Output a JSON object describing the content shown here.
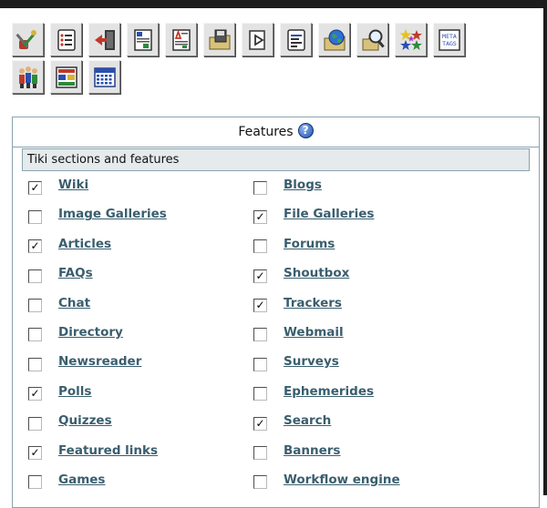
{
  "toolbar": {
    "rows": [
      [
        {
          "icon": "tools-icon"
        },
        {
          "icon": "list-icon"
        },
        {
          "icon": "login-icon"
        },
        {
          "icon": "wiki-page-icon"
        },
        {
          "icon": "article-page-icon"
        },
        {
          "icon": "floppy-folder-icon"
        },
        {
          "icon": "export-icon"
        },
        {
          "icon": "text-lines-icon"
        },
        {
          "icon": "globe-folder-icon"
        },
        {
          "icon": "search-folder-icon"
        },
        {
          "icon": "stars-icon"
        },
        {
          "icon": "meta-tags-icon",
          "label": "META\nTAGS"
        }
      ],
      [
        {
          "icon": "users-icon"
        },
        {
          "icon": "layout-icon"
        },
        {
          "icon": "calendar-icon"
        }
      ]
    ]
  },
  "panel": {
    "title": "Features",
    "help_symbol": "?",
    "section_title": "Tiki sections and features"
  },
  "features": [
    {
      "left": {
        "label": "Wiki",
        "checked": true
      },
      "right": {
        "label": "Blogs",
        "checked": false
      }
    },
    {
      "left": {
        "label": "Image Galleries",
        "checked": false
      },
      "right": {
        "label": "File Galleries",
        "checked": true
      }
    },
    {
      "left": {
        "label": "Articles",
        "checked": true
      },
      "right": {
        "label": "Forums",
        "checked": false
      }
    },
    {
      "left": {
        "label": "FAQs",
        "checked": false
      },
      "right": {
        "label": "Shoutbox",
        "checked": true
      }
    },
    {
      "left": {
        "label": "Chat",
        "checked": false
      },
      "right": {
        "label": "Trackers",
        "checked": true
      }
    },
    {
      "left": {
        "label": "Directory",
        "checked": false
      },
      "right": {
        "label": "Webmail",
        "checked": false
      }
    },
    {
      "left": {
        "label": "Newsreader",
        "checked": false
      },
      "right": {
        "label": "Surveys",
        "checked": false
      }
    },
    {
      "left": {
        "label": "Polls",
        "checked": true
      },
      "right": {
        "label": "Ephemerides",
        "checked": false
      }
    },
    {
      "left": {
        "label": "Quizzes",
        "checked": false
      },
      "right": {
        "label": "Search",
        "checked": true
      }
    },
    {
      "left": {
        "label": "Featured links",
        "checked": true
      },
      "right": {
        "label": "Banners",
        "checked": false
      }
    },
    {
      "left": {
        "label": "Games",
        "checked": false
      },
      "right": {
        "label": "Workflow engine",
        "checked": false
      }
    }
  ],
  "check_mark": "✓"
}
